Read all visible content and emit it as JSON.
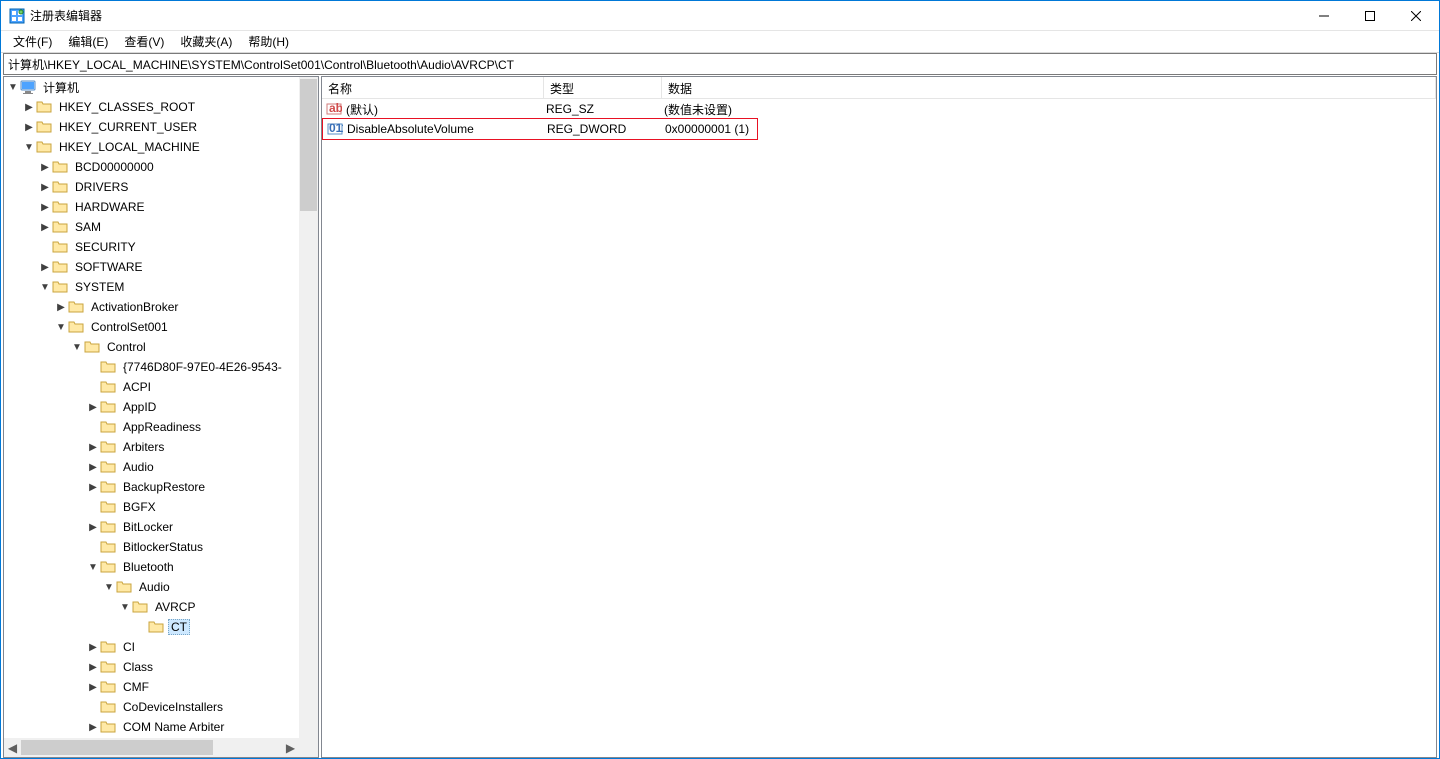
{
  "window": {
    "title": "注册表编辑器"
  },
  "menu": {
    "file": "文件(F)",
    "edit": "编辑(E)",
    "view": "查看(V)",
    "fav": "收藏夹(A)",
    "help": "帮助(H)"
  },
  "address": "计算机\\HKEY_LOCAL_MACHINE\\SYSTEM\\ControlSet001\\Control\\Bluetooth\\Audio\\AVRCP\\CT",
  "columns": {
    "name": "名称",
    "type": "类型",
    "data": "数据"
  },
  "rows": [
    {
      "icon": "string",
      "name": "(默认)",
      "type": "REG_SZ",
      "data": "(数值未设置)",
      "hl": false
    },
    {
      "icon": "dword",
      "name": "DisableAbsoluteVolume",
      "type": "REG_DWORD",
      "data": "0x00000001 (1)",
      "hl": true
    }
  ],
  "tree": {
    "root": "计算机",
    "hkcr": "HKEY_CLASSES_ROOT",
    "hkcu": "HKEY_CURRENT_USER",
    "hklm": "HKEY_LOCAL_MACHINE",
    "bcd": "BCD00000000",
    "drivers": "DRIVERS",
    "hardware": "HARDWARE",
    "sam": "SAM",
    "security": "SECURITY",
    "software": "SOFTWARE",
    "system": "SYSTEM",
    "activation": "ActivationBroker",
    "cs001": "ControlSet001",
    "control": "Control",
    "guid": "{7746D80F-97E0-4E26-9543-",
    "acpi": "ACPI",
    "appid": "AppID",
    "appready": "AppReadiness",
    "arbiters": "Arbiters",
    "audio": "Audio",
    "backup": "BackupRestore",
    "bgfx": "BGFX",
    "bitlocker": "BitLocker",
    "bitlockerstatus": "BitlockerStatus",
    "bluetooth": "Bluetooth",
    "btaudio": "Audio",
    "avrcp": "AVRCP",
    "ct": "CT",
    "ci": "CI",
    "class": "Class",
    "cmf": "CMF",
    "codev": "CoDeviceInstallers",
    "comname": "COM Name Arbiter"
  }
}
